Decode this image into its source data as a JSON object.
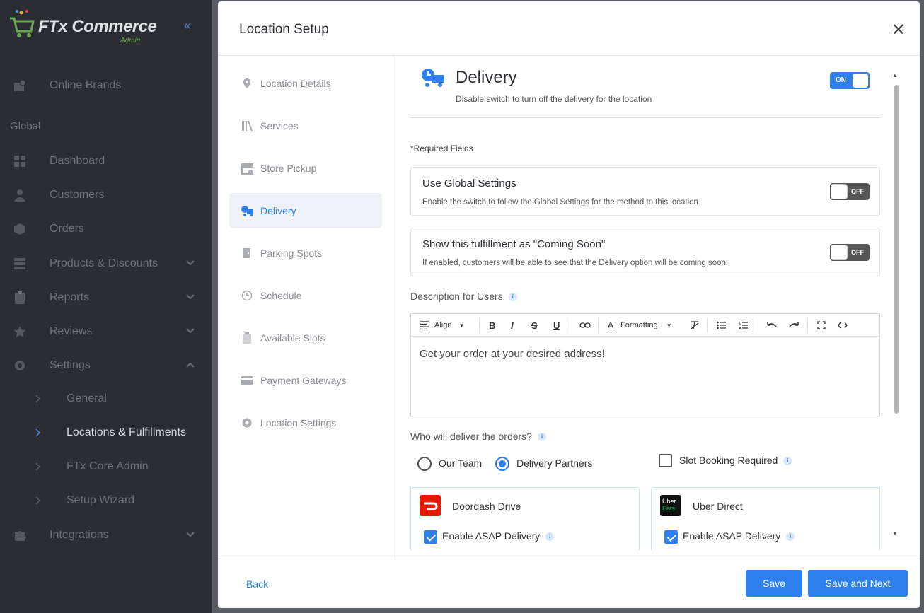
{
  "brand": {
    "name": "FTx Commerce",
    "sub": "Admin"
  },
  "sidebar": {
    "online_brands": "Online Brands",
    "global_label": "Global",
    "items": [
      {
        "label": "Dashboard"
      },
      {
        "label": "Customers"
      },
      {
        "label": "Orders"
      },
      {
        "label": "Products & Discounts"
      },
      {
        "label": "Reports"
      },
      {
        "label": "Reviews"
      },
      {
        "label": "Settings"
      }
    ],
    "settings_sub": [
      {
        "label": "General"
      },
      {
        "label": "Locations & Fulfillments"
      },
      {
        "label": "FTx Core Admin"
      },
      {
        "label": "Setup Wizard"
      }
    ],
    "integrations": "Integrations"
  },
  "modal": {
    "title": "Location Setup",
    "nav": [
      {
        "label": "Location Details"
      },
      {
        "label": "Services"
      },
      {
        "label": "Store Pickup"
      },
      {
        "label": "Delivery"
      },
      {
        "label": "Parking Spots"
      },
      {
        "label": "Schedule"
      },
      {
        "label": "Available Slots"
      },
      {
        "label": "Payment Gateways"
      },
      {
        "label": "Location Settings"
      }
    ],
    "delivery": {
      "title": "Delivery",
      "subtitle": "Disable switch to turn off the delivery for the location",
      "toggle": "ON",
      "required": "*Required Fields",
      "global": {
        "title": "Use Global Settings",
        "desc": "Enable the switch to follow the Global Settings for the method to this location",
        "toggle": "OFF"
      },
      "coming": {
        "title": "Show this fulfillment as \"Coming Soon\"",
        "desc": "If enabled, customers will be able to see that the Delivery option will be coming soon.",
        "toggle": "OFF"
      },
      "desc_label": "Description for Users",
      "toolbar": {
        "align": "Align",
        "formatting": "Formatting"
      },
      "editor_text": "Get your order at your desired address!",
      "who_label": "Who will deliver the orders?",
      "our_team": "Our Team",
      "partners": "Delivery Partners",
      "slot": "Slot Booking Required",
      "doordash": {
        "name": "Doordash Drive",
        "asap": "Enable ASAP Delivery"
      },
      "uber": {
        "name": "Uber Direct",
        "asap": "Enable ASAP Delivery",
        "logo_top": "Uber",
        "logo_bottom": "Eats"
      }
    },
    "footer": {
      "back": "Back",
      "save": "Save",
      "save_next": "Save and Next"
    }
  },
  "colors": {
    "accent": "#2f80ed",
    "sidebar": "#2b2d33"
  }
}
